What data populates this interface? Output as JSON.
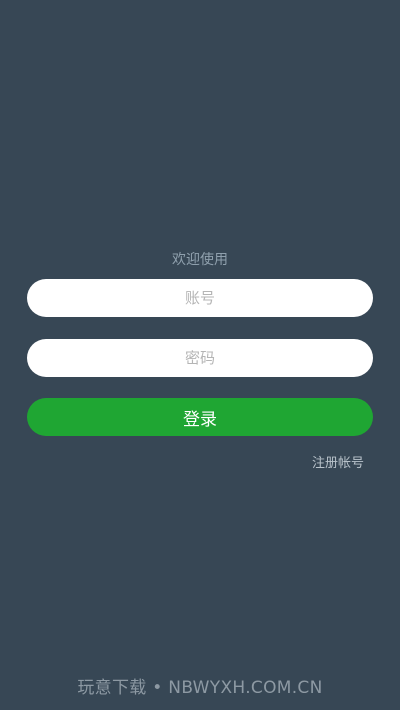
{
  "login": {
    "welcome_text": "欢迎使用",
    "username_placeholder": "账号",
    "password_placeholder": "密码",
    "login_label": "登录",
    "register_label": "注册帐号"
  },
  "watermark": {
    "text": "玩意下载 • NBWYXH.COM.CN"
  },
  "colors": {
    "background": "#374755",
    "login_button": "#1fa633",
    "field_background": "#ffffff"
  }
}
